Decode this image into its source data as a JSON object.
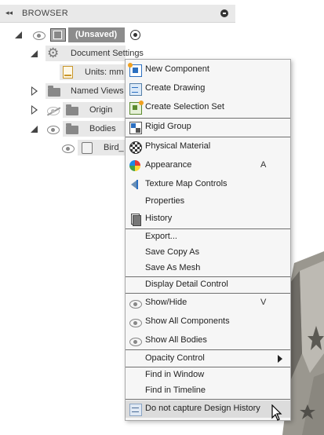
{
  "browser": {
    "collapse_glyph": "◂◂",
    "title": "BROWSER",
    "pin_icon": "pin-icon"
  },
  "tree": {
    "root_label": "(Unsaved)",
    "document_settings": "Document Settings",
    "units": "Units: mm",
    "named_views": "Named Views",
    "origin": "Origin",
    "bodies": "Bodies",
    "body_item": "Bird_"
  },
  "menu": {
    "items": [
      {
        "label": "New Component",
        "icon": "new-component-icon"
      },
      {
        "label": "Create Drawing",
        "icon": "create-drawing-icon"
      },
      {
        "label": "Create Selection Set",
        "icon": "selection-set-icon"
      },
      {
        "label": "Rigid Group",
        "icon": "rigid-group-icon"
      },
      {
        "label": "Physical Material",
        "icon": "physical-material-icon"
      },
      {
        "label": "Appearance",
        "icon": "appearance-icon",
        "shortcut": "A"
      },
      {
        "label": "Texture Map Controls",
        "icon": "texture-map-icon"
      },
      {
        "label": "Properties"
      },
      {
        "label": "History",
        "icon": "history-icon"
      },
      {
        "label": "Export..."
      },
      {
        "label": "Save Copy As"
      },
      {
        "label": "Save As Mesh"
      },
      {
        "label": "Display Detail Control"
      },
      {
        "label": "Show/Hide",
        "icon": "eye-icon",
        "shortcut": "V"
      },
      {
        "label": "Show All Components",
        "icon": "eye-icon"
      },
      {
        "label": "Show All Bodies",
        "icon": "eye-icon"
      },
      {
        "label": "Opacity Control",
        "submenu": true
      },
      {
        "label": "Find in Window"
      },
      {
        "label": "Find in Timeline"
      },
      {
        "label": "Do not capture Design History",
        "icon": "design-history-icon"
      }
    ]
  },
  "colors": {
    "menu_bg": "#f6f6f6",
    "highlight": "#dcdcdc",
    "accent_blue": "#2c6fc0"
  }
}
